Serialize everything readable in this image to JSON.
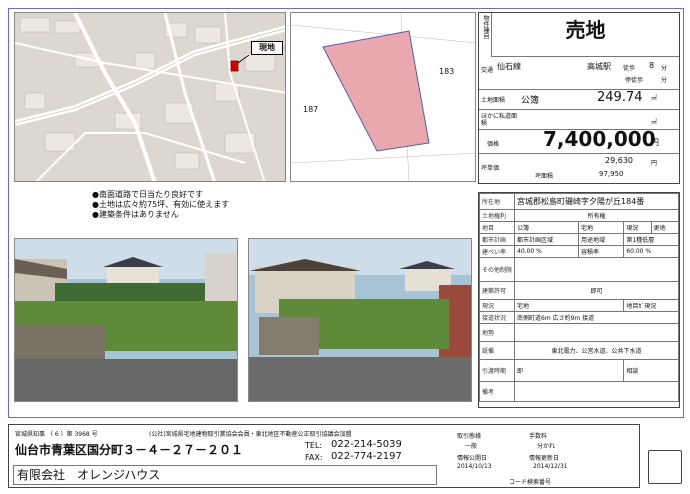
{
  "header": {
    "type_title": "売地",
    "side_label": "物件種目"
  },
  "map": {
    "site_label": "現地"
  },
  "plan": {
    "lot_left": "187",
    "lot_right": "183"
  },
  "bullets": [
    "●南面道路で日当たり良好です",
    "●土地は広々約75坪、有効に使えます",
    "●建築条件はありません"
  ],
  "property": {
    "transport_label": "交通",
    "line": "仙石線",
    "station": "高城駅",
    "walk_label": "徒歩",
    "walk_min": "8",
    "walk_unit": "分",
    "walk_label2": "停徒歩",
    "walk_unit2": "分",
    "land_label": "土地面積",
    "land_type": "公簿",
    "land_area": "249.74",
    "land_unit": "㎡",
    "other_area_label": "ほかに私道面積",
    "other_area_unit": "㎡",
    "price_label": "価格",
    "price": "7,400,000",
    "price_unit": "円",
    "tsubo_label": "坪単価",
    "tsubo_price": "29,630",
    "tsubo_unit": "円",
    "tsubo_area_label": "坪面積",
    "tsubo_area": "97,950"
  },
  "details": {
    "location_label": "所在地",
    "location": "宮城郡松島町磯崎字夕陽が丘184番",
    "rights_label": "土地権利",
    "rights": "所有権",
    "category_label": "地目",
    "category_kobo": "公簿",
    "category_kobo_val": "宅地",
    "category_genkyo": "現況",
    "category_genkyo_val": "更地",
    "zoning_label": "都市計画",
    "zoning": "都市計画区域",
    "use_label": "用途地域",
    "use": "第1種低層",
    "coverage_label": "建ぺい率",
    "coverage": "40.00",
    "coverage_unit": "%",
    "far_label": "容積率",
    "far": "60.00",
    "far_unit": "%",
    "other_limit_label": "その他制限",
    "permit_label": "建築許可",
    "permit": "即可",
    "current_label": "現況",
    "current_kobo": "宅地",
    "current_note": "地目ｶﾞ現況",
    "road_label": "接道状況",
    "road": "南側町道6m 広さ約9m 接道",
    "terrain_label": "地勢",
    "facilities_label": "設備",
    "facilities": "東北電力、公営水道、公共下水道",
    "delivery_label": "引渡時期",
    "delivery_a": "即",
    "delivery_b": "相談",
    "remarks_label": "備考"
  },
  "footer": {
    "license": "宮城県知事 （ 6 ）第 3968 号",
    "association": "(公社)宮城県宅地建物取引業協会会員・東北地区不動産公正取引協議会加盟",
    "address": "仙台市青葉区国分町３－４－２７－２０１",
    "tel_label": "TEL:",
    "tel": "022-214-5039",
    "fax_label": "FAX:",
    "fax": "022-774-2197",
    "company": "有限会社　オレンジハウス",
    "deal_label": "取引態様",
    "deal": "一般",
    "fee_label": "手数料",
    "fee": "分かれ",
    "date1_label": "情報公開日",
    "date1": "2014/10/13",
    "date2_label": "情報更新日",
    "date2": "2014/12/31",
    "code_label": "コード",
    "code_suffix": "検索番号"
  }
}
